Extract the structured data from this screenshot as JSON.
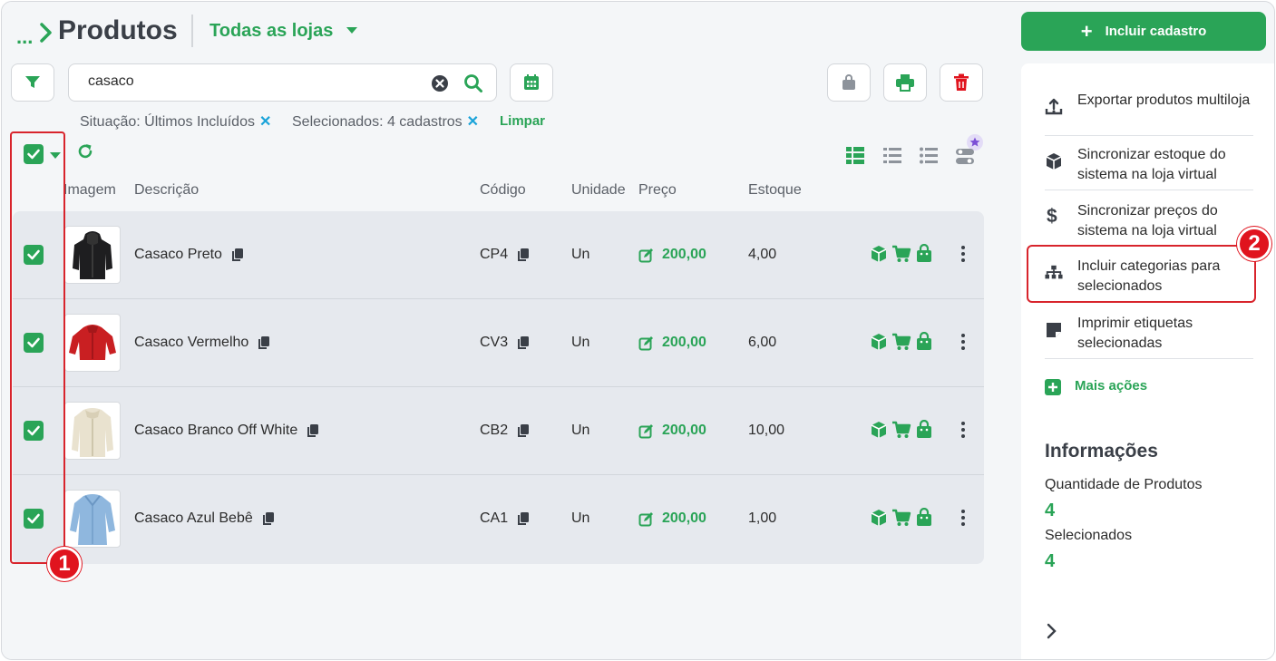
{
  "header": {
    "breadcrumb_dots": "...",
    "title": "Produtos",
    "store_selector": "Todas as lojas",
    "add_button": "Incluir cadastro"
  },
  "search": {
    "value": "casaco"
  },
  "filters": {
    "situacao": "Situação: Últimos Incluídos",
    "selecionados": "Selecionados: 4 cadastros",
    "clear": "Limpar"
  },
  "table": {
    "columns": [
      "Imagem",
      "Descrição",
      "Código",
      "Unidade",
      "Preço",
      "Estoque"
    ],
    "rows": [
      {
        "descricao": "Casaco Preto",
        "codigo": "CP4",
        "unidade": "Un",
        "preco": "200,00",
        "estoque": "4,00",
        "checked": true,
        "thumb": "black-hoodie"
      },
      {
        "descricao": "Casaco Vermelho",
        "codigo": "CV3",
        "unidade": "Un",
        "preco": "200,00",
        "estoque": "6,00",
        "checked": true,
        "thumb": "red-jacket"
      },
      {
        "descricao": "Casaco Branco Off White",
        "codigo": "CB2",
        "unidade": "Un",
        "preco": "200,00",
        "estoque": "10,00",
        "checked": true,
        "thumb": "offwhite-coat"
      },
      {
        "descricao": "Casaco Azul Bebê",
        "codigo": "CA1",
        "unidade": "Un",
        "preco": "200,00",
        "estoque": "1,00",
        "checked": true,
        "thumb": "lightblue-coat"
      }
    ]
  },
  "actions": [
    {
      "label": "Exportar produtos multiloja",
      "icon": "export-icon"
    },
    {
      "label": "Sincronizar estoque do sistema na loja virtual",
      "icon": "box-icon"
    },
    {
      "label": "Sincronizar preços do sistema na loja virtual",
      "icon": "dollar-icon"
    },
    {
      "label": "Incluir categorias para selecionados",
      "icon": "sitemap-icon"
    },
    {
      "label": "Imprimir etiquetas selecionadas",
      "icon": "label-icon"
    }
  ],
  "more_actions": "Mais ações",
  "info": {
    "title": "Informações",
    "qty_label": "Quantidade de Produtos",
    "qty_value": "4",
    "selected_label": "Selecionados",
    "selected_value": "4"
  },
  "annotations": {
    "badge1": "1",
    "badge2": "2"
  },
  "colors": {
    "accent": "#2aa457",
    "danger": "#e0141e",
    "info": "#1aa3d9"
  }
}
